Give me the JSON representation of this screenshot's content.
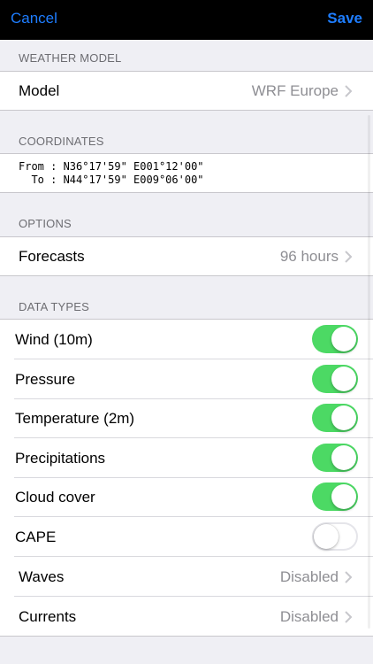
{
  "nav": {
    "cancel": "Cancel",
    "save": "Save"
  },
  "weather_model": {
    "header": "WEATHER MODEL",
    "model_label": "Model",
    "model_value": "WRF Europe"
  },
  "coordinates": {
    "header": "COORDINATES",
    "from_line": "From : N36°17'59\" E001°12'00\"",
    "to_line": "  To : N44°17'59\" E009°06'00\""
  },
  "options": {
    "header": "OPTIONS",
    "forecasts_label": "Forecasts",
    "forecasts_value": "96 hours"
  },
  "data_types": {
    "header": "DATA TYPES",
    "toggles": [
      {
        "label": "Wind (10m)",
        "on": true
      },
      {
        "label": "Pressure",
        "on": true
      },
      {
        "label": "Temperature (2m)",
        "on": true
      },
      {
        "label": "Precipitations",
        "on": true
      },
      {
        "label": "Cloud cover",
        "on": true
      },
      {
        "label": "CAPE",
        "on": false
      }
    ],
    "waves_label": "Waves",
    "waves_value": "Disabled",
    "currents_label": "Currents",
    "currents_value": "Disabled"
  },
  "colors": {
    "accent": "#1e7dff",
    "toggle_on": "#4cd964",
    "background": "#efeff4"
  },
  "icons": {
    "chevron": "chevron-right-icon",
    "toggle": "switch-toggle"
  }
}
